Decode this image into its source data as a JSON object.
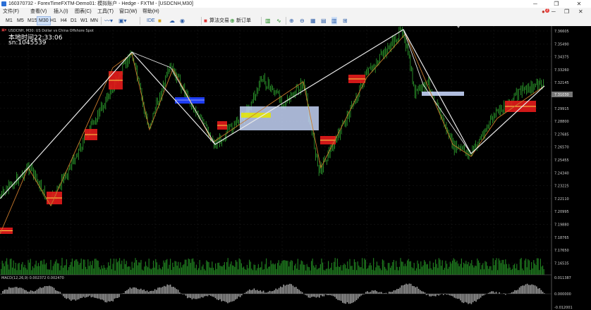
{
  "window": {
    "title": "160370732 - ForexTimeFXTM-Demo01: 模拟账户 - Hedge - FXTM - [USDCNH,M30]",
    "controls": [
      "─",
      "❐",
      "✕"
    ]
  },
  "menu": {
    "items": [
      "文件(F)",
      "查看(V)",
      "插入(I)",
      "图表(C)",
      "工具(T)",
      "窗口(W)",
      "帮助(H)"
    ],
    "notification_count": "2"
  },
  "toolbar": {
    "timeframes": [
      "M1",
      "M5",
      "M15",
      "M30",
      "H1",
      "H4",
      "D1",
      "W1",
      "MN"
    ],
    "active_timeframe": "M30",
    "ide_label": "IDE",
    "algo_label": "算法交易",
    "new_order_label": "新订单"
  },
  "chart": {
    "symbol_line": "USDCNH, M30:  US Dollar vs China Offshore Spot",
    "local_time": "本地时间22:33:06",
    "sn": "sn:1045539",
    "price_axis": [
      "7.36605",
      "7.35490",
      "7.34375",
      "7.33260",
      "7.32145",
      "7.31030",
      "7.29915",
      "7.28800",
      "7.27685",
      "7.26570",
      "7.25455",
      "7.24340",
      "7.23225",
      "7.22110",
      "7.20995",
      "7.19880",
      "7.18765",
      "7.17650",
      "7.16535"
    ],
    "current_price": "7.31030",
    "macd_label": "MACD(12,26,9) 0.002372 0.002470",
    "macd_axis": [
      "0.011387",
      "0.000000",
      "-0.012001"
    ],
    "colors": {
      "candles": "#2fa52f",
      "zigzag": "#e8e8e8",
      "trend": "#c97a2c",
      "supply": "#e51b1b",
      "demand": "#c4d3f7",
      "blue_zone": "#1f3fff"
    }
  }
}
